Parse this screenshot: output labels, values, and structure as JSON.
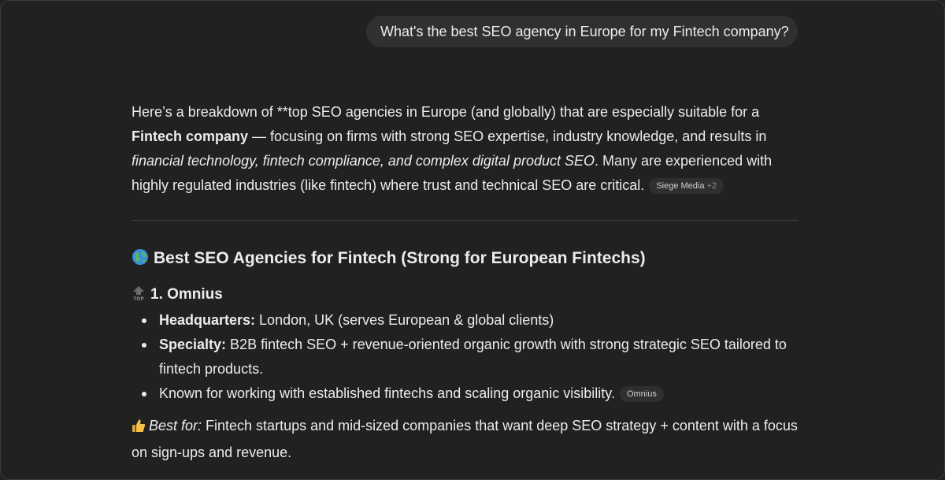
{
  "user_message": "What's the best SEO agency in Europe for my Fintech company?",
  "intro": {
    "part1": "Here’s a breakdown of **top SEO agencies in Europe (and globally) that are especially suitable for a ",
    "bold": "Fintech company",
    "part2": " — focusing on firms with strong SEO expertise, industry knowledge, and results in ",
    "italic": "financial technology, fintech compliance, and complex digital product SEO",
    "part3": ". Many are experienced with highly regulated industries (like fintech) where trust and technical SEO are critical.",
    "citation": {
      "label": "Siege Media",
      "more": "+2"
    }
  },
  "section_heading": {
    "icon": "globe-icon",
    "text": "Best SEO Agencies for Fintech (Strong for European Fintechs)"
  },
  "agency": {
    "icon": "top-arrow-icon",
    "title": "1. Omnius",
    "bullets": [
      {
        "label": "Headquarters:",
        "text": " London, UK (serves European & global clients)"
      },
      {
        "label": "Specialty:",
        "text": " B2B fintech SEO + revenue-oriented organic growth with strong strategic SEO tailored to fintech products."
      },
      {
        "label": "",
        "text": "Known for working with established fintechs and scaling organic visibility.",
        "citation": "Omnius"
      }
    ],
    "best_for": {
      "icon": "thumbs-up-icon",
      "label": "Best for:",
      "text": " Fintech startups and mid-sized companies that want deep SEO strategy + content with a focus on sign-ups and revenue."
    }
  }
}
